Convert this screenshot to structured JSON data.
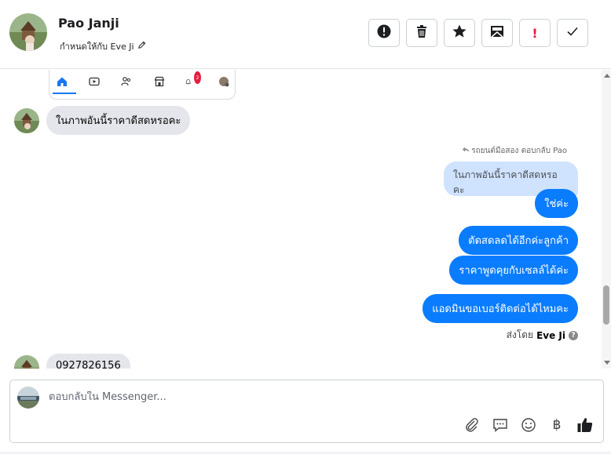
{
  "header": {
    "name": "Pao Janji",
    "assigned_text": "กำหนดให้กับ Eve Ji",
    "actions": [
      {
        "icon": "alert-circle-icon",
        "label": "!"
      },
      {
        "icon": "trash-icon",
        "label": ""
      },
      {
        "icon": "star-icon",
        "label": ""
      },
      {
        "icon": "mail-icon",
        "label": ""
      },
      {
        "icon": "spam-icon",
        "label": "!"
      },
      {
        "icon": "check-icon",
        "label": ""
      }
    ]
  },
  "shared_screenshot": {
    "notification_count": "2"
  },
  "messages": {
    "incoming_1": "ในภาพอันนี้ราคาดีสดหรอคะ",
    "reply_label": "รถยนต์มือสอง ตอบกลับ Pao",
    "reply_quote": "ในภาพอันนี้ราคาดีสดหรอคะ",
    "out_1": "ใช่ค่ะ",
    "out_2": "ตัดสดลดได้อีกค่ะลูกค้า",
    "out_3": "ราคาพูดคุยกับเซลล์ได้ค่ะ",
    "out_4": "แอดมินขอเบอร์ติดต่อได้ไหมคะ",
    "sent_by_prefix": "ส่งโดย",
    "sent_by_name": "Eve Ji",
    "help_symbol": "?",
    "incoming_2": "0927826156"
  },
  "composer": {
    "placeholder": "ตอบกลับใน Messenger...",
    "value": "",
    "currency_symbol": "฿",
    "tools": [
      "paperclip-icon",
      "speech-bubble-icon",
      "emoji-icon",
      "baht-icon",
      "thumbs-up-icon"
    ]
  },
  "colors": {
    "accent": "#0a7cff",
    "incoming_bubble": "#e4e6eb",
    "quote_bubble": "#cfe3ff",
    "spam_red": "#e41e3f"
  }
}
